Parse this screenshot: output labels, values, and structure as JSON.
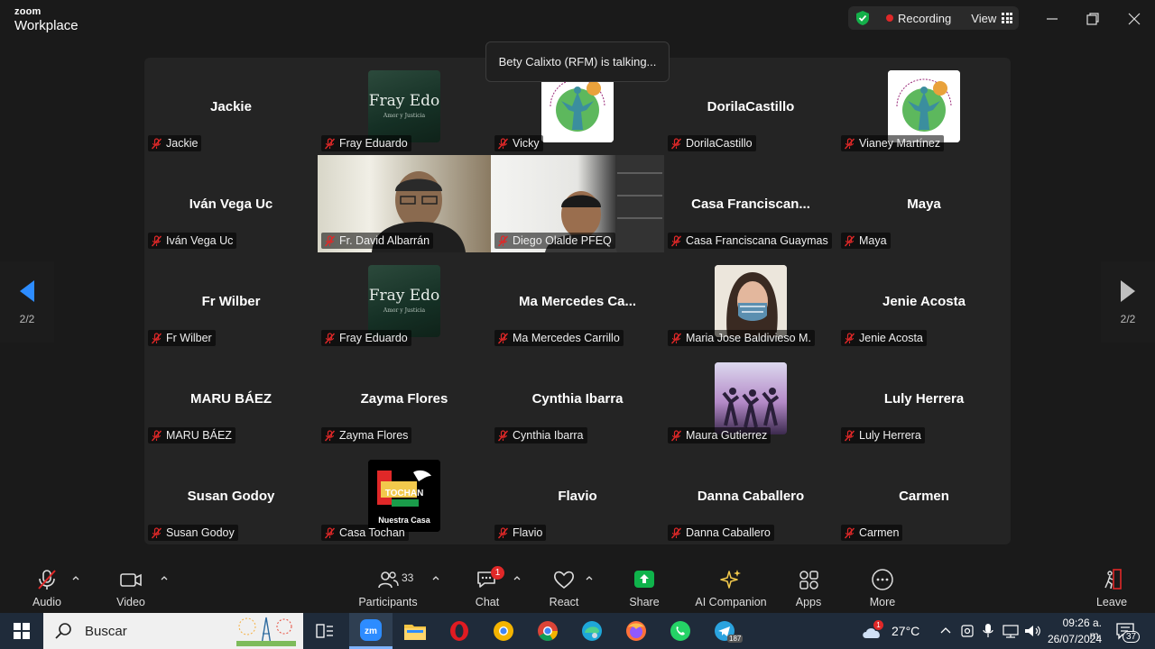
{
  "app": {
    "brand_line1": "zoom",
    "brand_line2": "Workplace"
  },
  "titlebar": {
    "recording_label": "Recording",
    "view_label": "View"
  },
  "toast": {
    "text": "Bety Calixto (RFM) is talking..."
  },
  "pagination": {
    "left_page": "2/2",
    "right_page": "2/2"
  },
  "tiles": [
    {
      "big": "Jackie",
      "name": "Jackie"
    },
    {
      "big": "",
      "name": "Fray Eduardo",
      "avatar": "fray-edo",
      "avatar_text": "Fray Edo",
      "avatar_sub": "Amor y Justicia"
    },
    {
      "big": "",
      "name": "Vicky",
      "avatar": "jpic"
    },
    {
      "big": "DorilaCastillo",
      "name": "DorilaCastillo"
    },
    {
      "big": "",
      "name": "Vianey Martínez",
      "avatar": "jpic"
    },
    {
      "big": "Iván Vega Uc",
      "name": "Iván Vega Uc"
    },
    {
      "big": "",
      "name": "Fr. David Albarrán",
      "video": "david"
    },
    {
      "big": "",
      "name": "Diego Olalde PFEQ",
      "video": "diego"
    },
    {
      "big": "Casa  Franciscan...",
      "name": "Casa Franciscana Guaymas"
    },
    {
      "big": "Maya",
      "name": "Maya"
    },
    {
      "big": "Fr Wilber",
      "name": "Fr Wilber"
    },
    {
      "big": "",
      "name": "Fray Eduardo",
      "avatar": "fray-edo",
      "avatar_text": "Fray Edo",
      "avatar_sub": "Amor y Justicia"
    },
    {
      "big": "Ma  Mercedes  Ca...",
      "name": "Ma Mercedes Carrillo"
    },
    {
      "big": "",
      "name": "Maria Jose Baldivieso M.",
      "avatar": "mask"
    },
    {
      "big": "Jenie Acosta",
      "name": "Jenie Acosta"
    },
    {
      "big": "MARU BÁEZ",
      "name": "MARU BÁEZ"
    },
    {
      "big": "Zayma Flores",
      "name": "Zayma Flores"
    },
    {
      "big": "Cynthia Ibarra",
      "name": "Cynthia Ibarra"
    },
    {
      "big": "",
      "name": "Maura Gutierrez",
      "avatar": "yoga"
    },
    {
      "big": "Luly Herrera",
      "name": "Luly Herrera"
    },
    {
      "big": "Susan Godoy",
      "name": "Susan Godoy"
    },
    {
      "big": "",
      "name": "Casa Tochan",
      "avatar": "tochan",
      "avatar_text": "Nuestra Casa"
    },
    {
      "big": "Flavio",
      "name": "Flavio"
    },
    {
      "big": "Danna Caballero",
      "name": "Danna Caballero"
    },
    {
      "big": "Carmen",
      "name": "Carmen"
    }
  ],
  "toolbar": {
    "audio": "Audio",
    "video": "Video",
    "participants": "Participants",
    "participants_count": "33",
    "chat": "Chat",
    "chat_badge": "1",
    "react": "React",
    "share": "Share",
    "ai": "AI Companion",
    "apps": "Apps",
    "more": "More",
    "leave": "Leave"
  },
  "taskbar": {
    "search_placeholder": "Buscar",
    "weather_temp": "27°C",
    "weather_badge": "1",
    "time": "09:26 a. m.",
    "date": "26/07/2024",
    "notif_count": "37",
    "telegram_badge": "187"
  },
  "colors": {
    "accent_green": "#14b04a",
    "mute_red": "#e02828",
    "share_green": "#0fb34b"
  }
}
